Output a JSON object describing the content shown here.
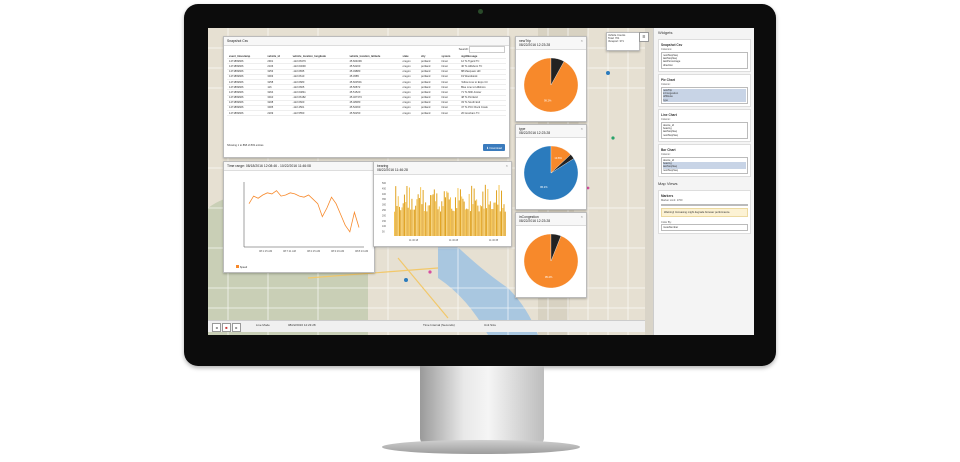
{
  "snapshot": {
    "title": "Snapshot Csv",
    "search_label": "Search:",
    "columns": [
      "event_timestamp",
      "vehicle_id",
      "vehicle_location_longitude",
      "vehicle_location_latitude",
      "state",
      "city",
      "system",
      "signMessage"
    ],
    "rows": [
      [
        "1471869666",
        "2901",
        "-122.66379",
        "45.604099",
        "oregon",
        "portland",
        "trimet",
        "12 To Tigard TC"
      ],
      [
        "1471869666",
        "2106",
        "-122.64690",
        "45.52200",
        "oregon",
        "portland",
        "trimet",
        "46 To Hillsboro TC"
      ],
      [
        "1471869666",
        "3253",
        "-122.6835",
        "45.49880",
        "oregon",
        "portland",
        "trimet",
        "88 Macquam Hill"
      ],
      [
        "1471869666",
        "3003",
        "-122.6610",
        "45.4585",
        "oregon",
        "portland",
        "trimet",
        "19 Woodstock"
      ],
      [
        "1471869666",
        "3258",
        "-122.6680",
        "45.603501",
        "oregon",
        "portland",
        "trimet",
        "Yellow Line to Expo Ctr"
      ],
      [
        "1471869666",
        "116",
        "-122.6665",
        "45.50872",
        "oregon",
        "portland",
        "trimet",
        "Blue Line to Hillsboro"
      ],
      [
        "1471869666",
        "3264",
        "-122.64841",
        "45.51520",
        "oregon",
        "portland",
        "trimet",
        "71 To 60th-Foster"
      ],
      [
        "1471869666",
        "3010",
        "-122.66182",
        "45.467373",
        "oregon",
        "portland",
        "trimet",
        "48 To Portland"
      ],
      [
        "1471869666",
        "3208",
        "-122.6600",
        "45.48380",
        "oregon",
        "portland",
        "trimet",
        "33 To South End"
      ],
      [
        "1471869666",
        "3005",
        "-122.4501",
        "45.52360",
        "oregon",
        "portland",
        "trimet",
        "47 To PCC Rock Creek"
      ],
      [
        "1471869666",
        "2209",
        "-122.5550",
        "45.50250",
        "oregon",
        "portland",
        "trimet",
        "20 Gresham TC"
      ]
    ],
    "footer": "Showing 1 to 868 of 803 entries",
    "download_label": "Download"
  },
  "time_range": {
    "title": "Time range: 08/18/2016 12:08:46 - 10/22/2016 11:46:08",
    "ticks": [
      "08:1:15 AM",
      "08:7:11 AM",
      "08:2:15 AM",
      "08:3:19 AM",
      "08:8:13 AM"
    ],
    "legend": "Speed",
    "values": [
      40,
      47,
      45,
      48,
      50,
      49,
      52,
      47,
      48,
      50,
      49,
      47,
      46,
      48,
      44,
      40,
      28,
      36,
      46,
      40,
      30,
      20,
      14,
      32,
      18
    ]
  },
  "bearing": {
    "title": "bearing",
    "date": "08/22/2016 11:46:28",
    "ticks": [
      "500",
      "450",
      "400",
      "350",
      "300",
      "250",
      "200",
      "150",
      "100",
      "50"
    ],
    "xticks": [
      "11:46:18",
      "11:46:28",
      "11:46:38"
    ]
  },
  "pies": [
    {
      "title": "newTrip",
      "date": "08/22/2016 12:23:28",
      "slices": [
        {
          "label": "99.2%",
          "value": 0.92,
          "color": "#f7892b"
        },
        {
          "label": "",
          "value": 0.08,
          "color": "#222"
        }
      ]
    },
    {
      "title": "type",
      "date": "08/22/2016 12:23:28",
      "slices": [
        {
          "label": "86.2%",
          "value": 0.84,
          "color": "#2b7bbd"
        },
        {
          "label": "13.8%",
          "value": 0.13,
          "color": "#f7892b"
        },
        {
          "label": "",
          "value": 0.03,
          "color": "#222"
        }
      ]
    },
    {
      "title": "inCongestion",
      "date": "08/22/2016 12:23:28",
      "slices": [
        {
          "label": "95.4%",
          "value": 0.94,
          "color": "#f7892b"
        },
        {
          "label": "",
          "value": 0.06,
          "color": "#222"
        }
      ]
    }
  ],
  "vehicle_counts": {
    "title": "Vehicle Counts",
    "total_label": "Total:",
    "total": "701",
    "viewport_label": "Viewport:",
    "viewport": "371"
  },
  "sidebar": {
    "title": "Widgets",
    "snapshot": {
      "label": "Snapshot Csv",
      "columns_label": "Columns:",
      "options": [
        "nextStopSeq",
        "lastStopSeq",
        "lastPercentage",
        "direction"
      ]
    },
    "pie": {
      "label": "Pie Chart",
      "columns_label": "Column:",
      "options": [
        "newTrip",
        "inCongestion",
        "offRoute",
        "type"
      ]
    },
    "line": {
      "label": "Line Chart",
      "columns_label": "Column:",
      "options": [
        "device_id",
        "bearing",
        "lastStopSeq",
        "nextStopSeq"
      ]
    },
    "bar": {
      "label": "Bar Chart",
      "columns_label": "Column:",
      "options": [
        "device_id",
        "bearing",
        "lastStopSeq",
        "nextStopSeq"
      ]
    },
    "map_views": "Map Views",
    "markers": {
      "label": "Markers",
      "limit_label": "Marker Limit:",
      "limit": "1700",
      "warning": "Warning! Increasing might degrade browser performance.",
      "color_label": "Color By:",
      "color_value": "routeNumber"
    }
  },
  "bottombar": {
    "live_mode": "Live Mode",
    "timestamp": "08/22/2016 12:23:28",
    "time_interval": "Time Interval (Seconds)",
    "unit": "Unit Size"
  },
  "colors": {
    "accent": "#3a7bbd",
    "orange": "#f7892b",
    "blue": "#2b7bbd"
  }
}
